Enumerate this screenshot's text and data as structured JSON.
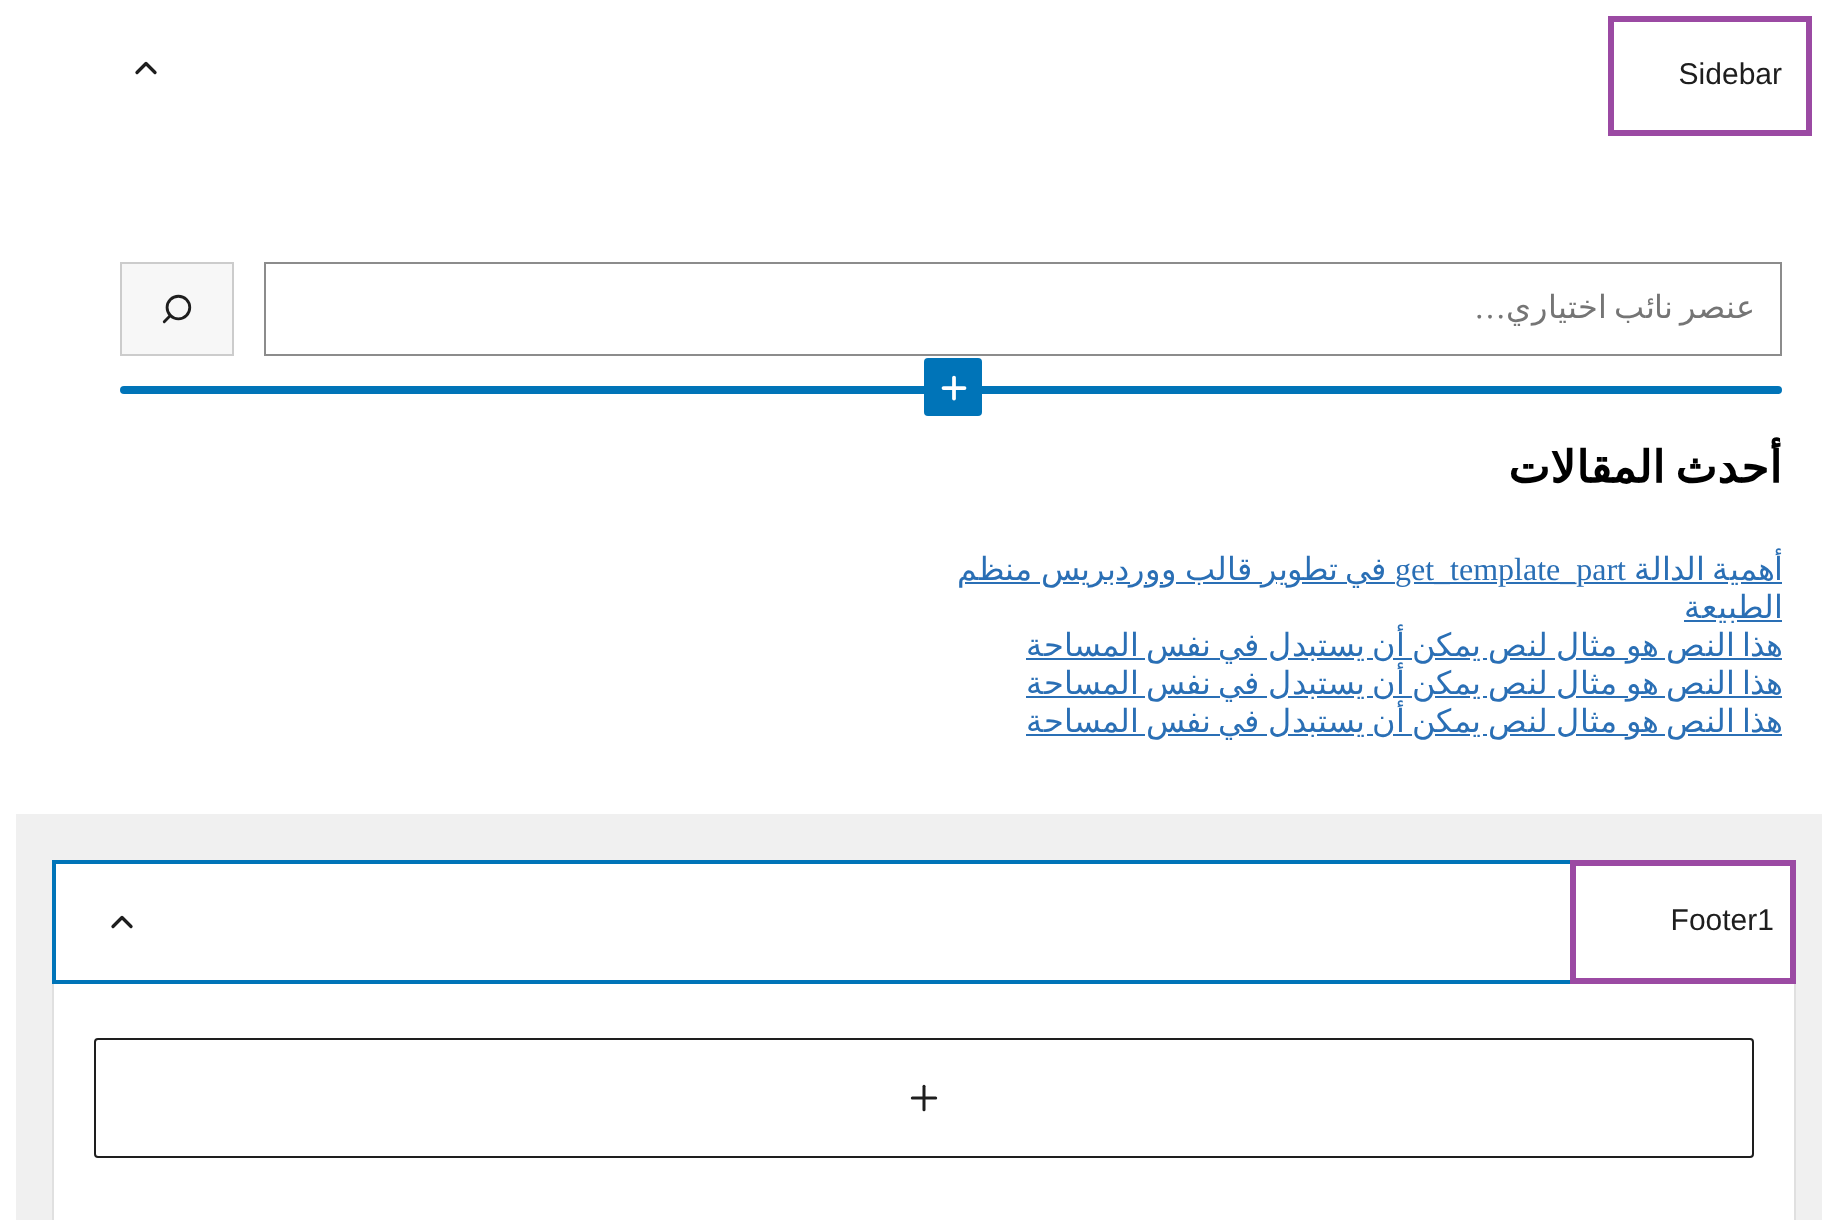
{
  "sidebar_area": {
    "title": "Sidebar",
    "search": {
      "placeholder": "عنصر نائب اختياري…"
    },
    "widget": {
      "heading": "أحدث المقالات",
      "posts": [
        "أهمية الدالة get_template_part في تطوير قالب ووردبريس منظم الطبيعة",
        "هذا النص هو مثال لنص يمكن أن يستبدل في نفس المساحة",
        "هذا النص هو مثال لنص يمكن أن يستبدل في نفس المساحة",
        "هذا النص هو مثال لنص يمكن أن يستبدل في نفس المساحة"
      ]
    }
  },
  "footer_area": {
    "title": "Footer1"
  }
}
